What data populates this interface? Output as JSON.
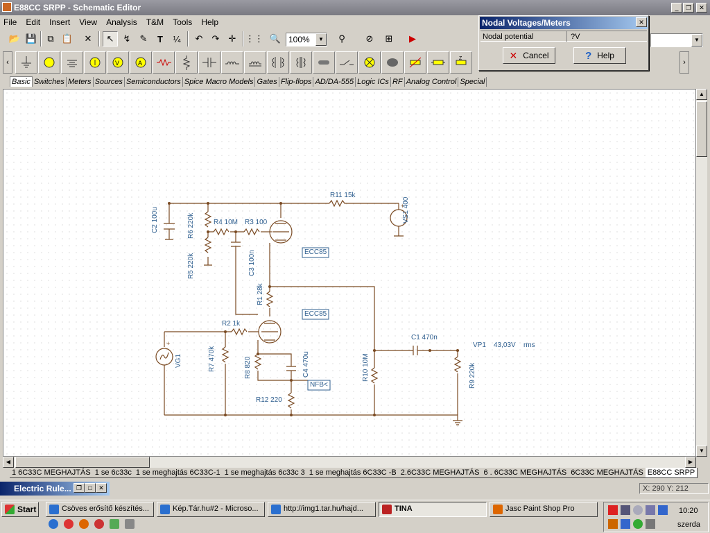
{
  "window": {
    "title": "E88CC SRPP - Schematic Editor"
  },
  "menu": [
    "File",
    "Edit",
    "Insert",
    "View",
    "Analysis",
    "T&M",
    "Tools",
    "Help"
  ],
  "toolbar": {
    "zoom": "100%"
  },
  "dialog": {
    "title": "Nodal Voltages/Meters",
    "field_label": "Nodal potential",
    "field_value": "?V",
    "cancel_label": "Cancel",
    "help_label": "Help"
  },
  "category_tabs": [
    "Basic",
    "Switches",
    "Meters",
    "Sources",
    "Semiconductors",
    "Spice Macro Models",
    "Gates",
    "Flip-flops",
    "AD/DA-555",
    "Logic ICs",
    "RF",
    "Analog Control",
    "Special"
  ],
  "schematic": {
    "labels": {
      "r11": "R11 15k",
      "vs1": "VS1 400",
      "c2": "C2 100u",
      "r6": "R6 220k",
      "r4": "R4 10M",
      "r3": "R3 100",
      "r5": "R5 220k",
      "c3": "C3 100n",
      "ecc_top": "ECC85",
      "r1": "R1 28k",
      "ecc_bottom": "ECC85",
      "r2": "R2 1k",
      "vg1": "VG1",
      "r7": "R7 470k",
      "r8": "R8 820",
      "c4": "C4 470u",
      "nfb": "NFB<",
      "r12": "R12 220",
      "r10": "R10 10M",
      "c1": "C1 470n",
      "vp1": "VP1",
      "vp1_value": "43,03V",
      "vp1_unit": "rms",
      "r9": "R9 220k"
    }
  },
  "sheet_tabs": [
    "1 6C33C MEGHAJTÁS",
    "1 se 6c33c",
    "1 se meghajtás 6C33C-1",
    "1 se meghajtás 6c33c 3",
    "1 se meghajtás 6C33C -B",
    "2.6C33C MEGHAJTÁS",
    "6 . 6C33C MEGHAJTÁS",
    "6C33C MEGHAJTÁS",
    "E88CC SRPP"
  ],
  "status": {
    "coords": "X: 290  Y: 212"
  },
  "minimized_window": {
    "title": "Electric Rule..."
  },
  "taskbar": {
    "start": "Start",
    "tasks": [
      "Csöves erősítő készítés...",
      "Kép.Tár.hu#2 - Microso...",
      "http://img1.tar.hu/hajd...",
      "TINA",
      "Jasc Paint Shop Pro"
    ],
    "clock": "10:20",
    "day": "szerda"
  },
  "colors": {
    "wire": "#7a4a22",
    "label": "#2f5f8f",
    "desktop_bar": "#0a246a"
  }
}
